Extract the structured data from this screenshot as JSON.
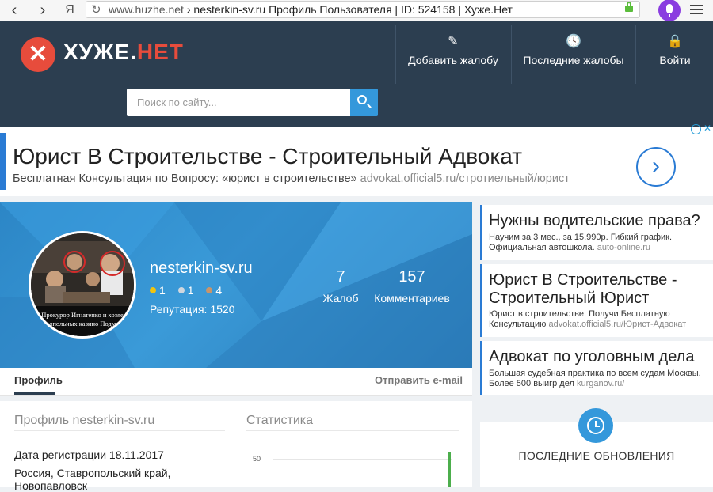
{
  "browser": {
    "back_glyph": "‹",
    "forward_glyph": "›",
    "yandex_glyph": "Я",
    "url_domain": "www.huzhe.net",
    "url_separator": "›",
    "url_title": "nesterkin-sv.ru Профиль Пользователя | ID: 524158 | Хуже.Нет",
    "icons": [
      "back-icon",
      "forward-icon",
      "yandex-icon",
      "refresh-icon",
      "lock-icon",
      "mic-icon",
      "menu-icon"
    ]
  },
  "header": {
    "logo_main": "ХУЖЕ.",
    "logo_accent": "НЕТ",
    "logo_glyph": "✕",
    "nav": [
      {
        "label": "Добавить жалобу",
        "icon": "pen-icon",
        "glyph": "✎"
      },
      {
        "label": "Последние жалобы",
        "icon": "clock-icon",
        "glyph": "🕓"
      },
      {
        "label": "Войти",
        "icon": "lock-icon",
        "glyph": "🔒"
      }
    ],
    "search_placeholder": "Поиск по сайту..."
  },
  "ad_top": {
    "title": "Юрист В Строительстве - Строительный Адвокат",
    "desc": "Бесплатная Консультация по Вопросу: «юрист в строительстве»",
    "url": "advokat.official5.ru/стротиельный/юрист",
    "arrow": "›",
    "adchoice": "i"
  },
  "profile": {
    "username": "nesterkin-sv.ru",
    "badges": [
      {
        "value": "1",
        "color": "#f1c40f"
      },
      {
        "value": "1",
        "color": "#d0d7de"
      },
      {
        "value": "4",
        "color": "#c8956b"
      }
    ],
    "reputation_label": "Репутация:",
    "reputation_value": "1520",
    "stats": [
      {
        "value": "7",
        "label": "Жалоб"
      },
      {
        "value": "157",
        "label": "Комментариев"
      }
    ],
    "avatar_caption_1": "Прокурор Игнатенко и хозяе",
    "avatar_caption_2": "подпольных казино Подмос"
  },
  "tabs": {
    "profile": "Профиль",
    "email": "Отправить e-mail"
  },
  "content": {
    "profile_heading": "Профиль nesterkin-sv.ru",
    "stats_heading": "Статистика",
    "regdate": "Дата регистрации 18.11.2017",
    "location": "Россия, Ставропольский край, Новопавловск",
    "chart_tick": "50"
  },
  "side_ads": [
    {
      "title": "Нужны водительские права?",
      "desc": "Научим за 3 мес., за 15.990р. Гибкий график. Официальная автошкола.",
      "url": "auto-online.ru"
    },
    {
      "title": "Юрист В Строительстве - Строительный Юрист",
      "desc": "Юрист в строительстве. Получи Бесплатную Консультацию",
      "url": "advokat.official5.ru/Юрист-Адвокат"
    },
    {
      "title": "Адвокат по уголовным дела",
      "desc": "Большая судебная практика по всем судам Москвы. Более 500 выигр дел",
      "url": "kurganov.ru/"
    }
  ],
  "updates": {
    "title": "ПОСЛЕДНИЕ ОБНОВЛЕНИЯ",
    "icon": "clock-icon"
  },
  "colors": {
    "header_bg": "#2c3e50",
    "brand_red": "#e74c3c",
    "accent_blue": "#3498db",
    "ad_blue": "#2a7bd4"
  }
}
